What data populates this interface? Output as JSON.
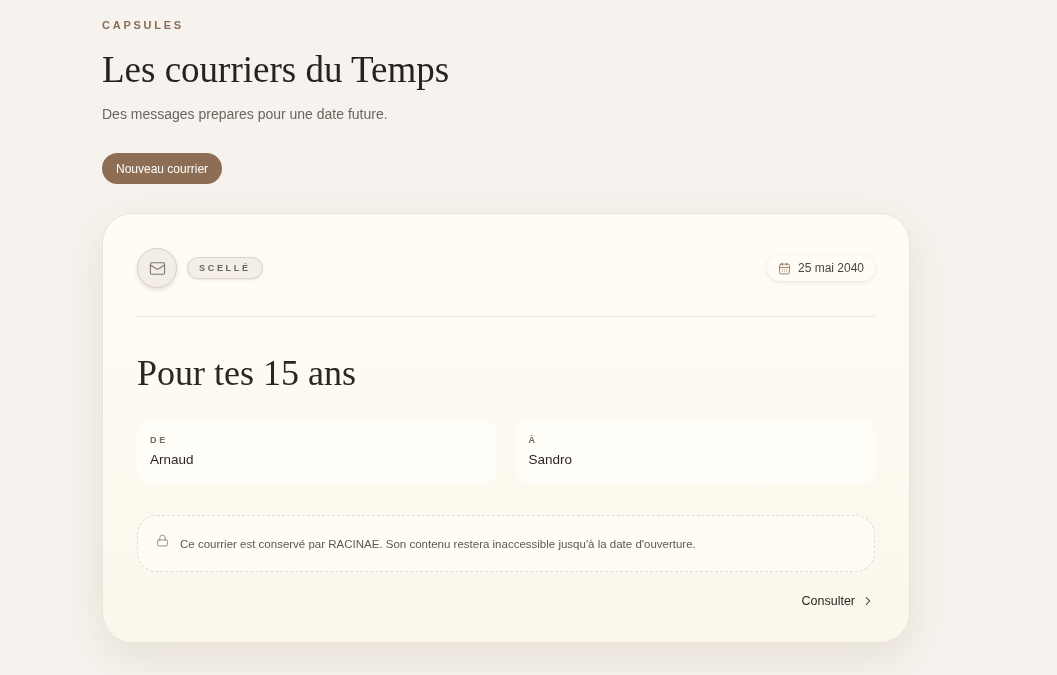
{
  "header": {
    "eyebrow": "CAPSULES",
    "title": "Les courriers du Temps",
    "subtitle": "Des messages prepares pour une date future.",
    "new_button": "Nouveau courrier"
  },
  "letters": [
    {
      "status": "SCELLÉ",
      "date": "25 mai 2040",
      "title": "Pour tes 15 ans",
      "fields": [
        {
          "label": "DE",
          "value": "Arnaud"
        },
        {
          "label": "À",
          "value": "Sandro"
        }
      ],
      "notice": "Ce courrier est conservé par RACINAE. Son contenu restera inaccessible jusqu'à la date d'ouverture.",
      "action": "Consulter"
    }
  ]
}
